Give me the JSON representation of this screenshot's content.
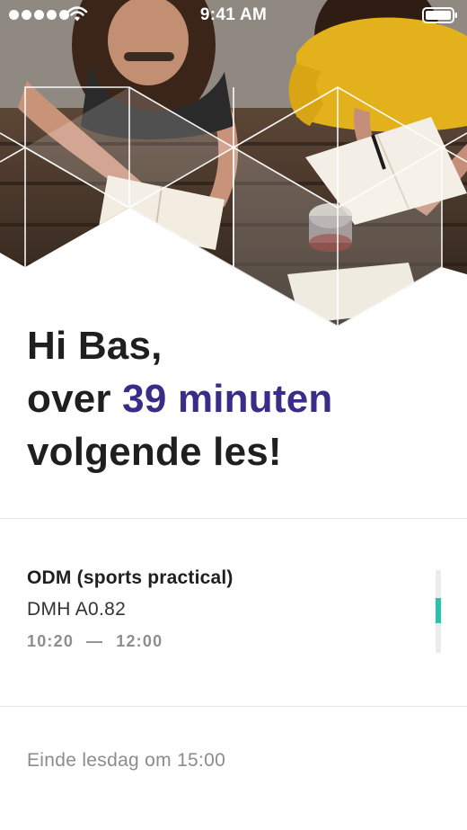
{
  "status_bar": {
    "time": "9:41 AM"
  },
  "greeting": {
    "line1": "Hi Bas,",
    "line2_prefix": "over ",
    "line2_highlight": "39 minuten",
    "line3": "volgende les!"
  },
  "lesson": {
    "title": "ODM (sports practical)",
    "room": "DMH A0.82",
    "start": "10:20",
    "separator": "—",
    "end": "12:00",
    "progress_fraction": 0.42
  },
  "footer": {
    "day_end": "Einde lesdag om 15:00"
  },
  "colors": {
    "accent": "#3a2d8a",
    "progress": "#27c4b0",
    "text": "#1f1f1f",
    "muted": "#8c8c8c"
  }
}
